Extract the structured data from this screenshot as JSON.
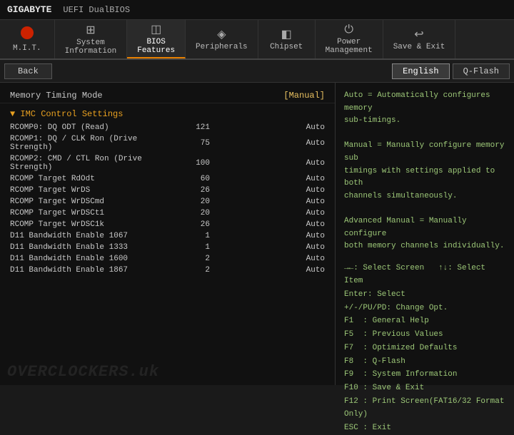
{
  "titlebar": {
    "brand": "GIGABYTE",
    "separator": "|",
    "dual_bios": "UEFI DualBIOS"
  },
  "nav": {
    "items": [
      {
        "id": "mit",
        "label": "M.I.T.",
        "icon": "circle",
        "active": false
      },
      {
        "id": "sysinfo",
        "label": "System\nInformation",
        "icon": "⊞",
        "active": false
      },
      {
        "id": "bios",
        "label": "BIOS\nFeatures",
        "icon": "◫",
        "active": true
      },
      {
        "id": "peripherals",
        "label": "Peripherals",
        "icon": "◈",
        "active": false
      },
      {
        "id": "chipset",
        "label": "Chipset",
        "icon": "◧",
        "active": false
      },
      {
        "id": "power",
        "label": "Power\nManagement",
        "icon": "⏻",
        "active": false
      },
      {
        "id": "save",
        "label": "Save & Exit",
        "icon": "↩",
        "active": false
      }
    ]
  },
  "toolbar": {
    "back_label": "Back",
    "lang_label": "English",
    "qflash_label": "Q-Flash"
  },
  "main": {
    "top_setting": {
      "label": "Memory Timing Mode",
      "value": "[Manual]"
    },
    "imc_header": "▼ IMC Control Settings",
    "settings": [
      {
        "label": "RCOMP0: DQ ODT (Read)",
        "num": "121",
        "auto": "Auto"
      },
      {
        "label": "RCOMP1: DQ / CLK Ron (Drive Strength)",
        "num": "75",
        "auto": "Auto"
      },
      {
        "label": "RCOMP2: CMD / CTL Ron (Drive Strength)",
        "num": "100",
        "auto": "Auto"
      },
      {
        "label": "RCOMP Target RdOdt",
        "num": "60",
        "auto": "Auto"
      },
      {
        "label": "RCOMP Target WrDS",
        "num": "26",
        "auto": "Auto"
      },
      {
        "label": "RCOMP Target WrDSCmd",
        "num": "20",
        "auto": "Auto"
      },
      {
        "label": "RCOMP Target WrDSCt1",
        "num": "20",
        "auto": "Auto"
      },
      {
        "label": "RCOMP Target WrDSC1k",
        "num": "26",
        "auto": "Auto"
      },
      {
        "label": "D11 Bandwidth Enable 1067",
        "num": "1",
        "auto": "Auto"
      },
      {
        "label": "D11 Bandwidth Enable 1333",
        "num": "1",
        "auto": "Auto"
      },
      {
        "label": "D11 Bandwidth Enable 1600",
        "num": "2",
        "auto": "Auto"
      },
      {
        "label": "D11 Bandwidth Enable 1867",
        "num": "2",
        "auto": "Auto"
      }
    ]
  },
  "help": {
    "description": [
      "Auto = Automatically configures memory sub-timings.",
      "",
      "Manual = Manually configure memory sub timings with settings applied to both channels simultaneously.",
      "",
      "Advanced Manual = Manually configure both memory channels individually."
    ],
    "keys": [
      {
        "key": "→←: Select Screen",
        "desc": "↑↓: Select Item"
      },
      {
        "key": "Enter: Select",
        "desc": ""
      },
      {
        "key": "+/-/PU/PD: Change Opt.",
        "desc": ""
      },
      {
        "key": "F1 : General Help",
        "desc": ""
      },
      {
        "key": "F5 : Previous Values",
        "desc": ""
      },
      {
        "key": "F7 : Optimized Defaults",
        "desc": ""
      },
      {
        "key": "F8 : Q-Flash",
        "desc": ""
      },
      {
        "key": "F9 : System Information",
        "desc": ""
      },
      {
        "key": "F10 : Save & Exit",
        "desc": ""
      },
      {
        "key": "F12 : Print Screen(FAT16/32 Format Only)",
        "desc": ""
      },
      {
        "key": "ESC : Exit",
        "desc": ""
      }
    ]
  },
  "watermark": "OVERCLOCKERS.uk"
}
